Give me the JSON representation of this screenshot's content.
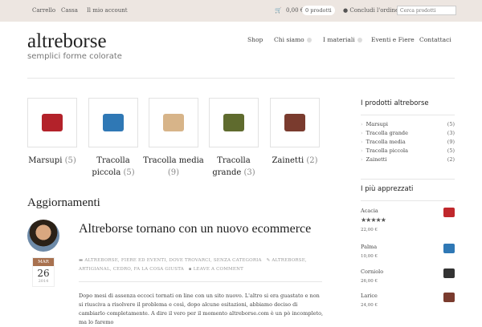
{
  "topbar": {
    "links": [
      "Carrello",
      "Cassa",
      "Il mio account"
    ],
    "cart_total": "0,00 €",
    "cart_count": "0 prodotti",
    "checkout": "Concludi l'ordine",
    "search_placeholder": "Cerca prodotti"
  },
  "header": {
    "logo": "altreborse",
    "tagline": "semplici forme colorate"
  },
  "nav": [
    "Shop",
    "Chi siamo",
    "I materiali",
    "Eventi e Fiere",
    "Contattaci"
  ],
  "categories": [
    {
      "name": "Marsupi",
      "count": "(5)",
      "color": "#b3222a"
    },
    {
      "name": "Tracolla piccola",
      "count": "(5)",
      "color": "#2f78b5"
    },
    {
      "name": "Tracolla media",
      "count": "(9)",
      "color": "#d7b489"
    },
    {
      "name": "Tracolla grande",
      "count": "(3)",
      "color": "#5f6b2e"
    },
    {
      "name": "Zainetti",
      "count": "(2)",
      "color": "#7a3b2e"
    }
  ],
  "updates_heading": "Aggiornamenti",
  "post": {
    "month": "MAR",
    "day": "26",
    "year": "2014",
    "title": "Altreborse tornano con un nuovo ecommerce",
    "categories": "ALTREBORSE, FIERE ED EVENTI, DOVE TROVARCI, SENZA CATEGORIA",
    "tags": "ALTREBORSE, ARTIGIANAL, CEDRO, FA LA COSA GIUSTA",
    "comment": "LEAVE A COMMENT",
    "text": "Dopo mesi di assenza eccoci tornati on line con un sito nuovo. L'altro si era guastato e non si riusciva a risolvere il problema  e così,  dopo alcune esitazioni, abbiamo deciso di cambiarlo completamente. A dire il vero per il momento altreborse.com è un pò incompleto, ma lo faremo"
  },
  "sidebar": {
    "products_title": "I prodotti altreborse",
    "product_cats": [
      {
        "name": "Marsupi",
        "count": "(5)"
      },
      {
        "name": "Tracolla grande",
        "count": "(3)"
      },
      {
        "name": "Tracolla media",
        "count": "(9)"
      },
      {
        "name": "Tracolla piccola",
        "count": "(5)"
      },
      {
        "name": "Zainetti",
        "count": "(2)"
      }
    ],
    "top_title": "I più apprezzati",
    "top": [
      {
        "name": "Acacia",
        "stars": "★★★★★",
        "rating": 5,
        "price": "22,00 €",
        "color": "#c0282c"
      },
      {
        "name": "Palma",
        "price": "10,00 €",
        "color": "#2f78b5"
      },
      {
        "name": "Corniolo",
        "price": "26,00 €",
        "color": "#333"
      },
      {
        "name": "Larice",
        "price": "24,00 €",
        "color": "#7a3b2e"
      }
    ]
  }
}
